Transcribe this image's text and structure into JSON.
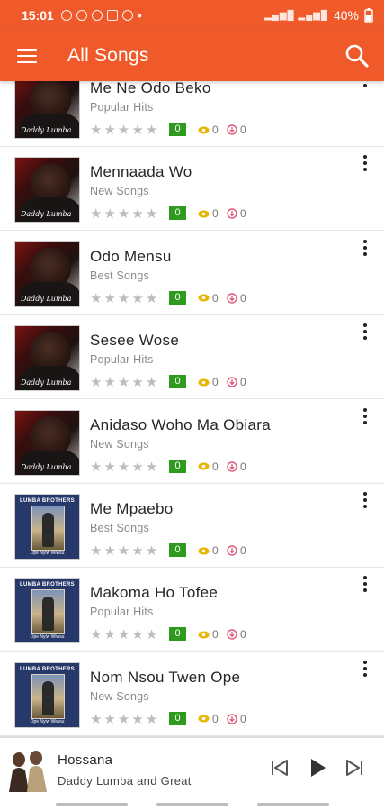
{
  "status_bar": {
    "time": "15:01",
    "battery": "40%",
    "notification_icons": [
      "whatsapp-icon",
      "whatsapp-icon",
      "whatsapp-icon",
      "gallery-icon",
      "xbox-icon",
      "dot-icon"
    ]
  },
  "app_bar": {
    "title": "All Songs",
    "menu_icon": "hamburger-menu-icon",
    "search_icon": "search-icon"
  },
  "colors": {
    "primary": "#f05a2a",
    "rating_badge": "#2e9a1e",
    "views_icon": "#e8b500",
    "downloads_icon": "#e05a7a"
  },
  "songs": [
    {
      "title": "Me Ne Odo Beko",
      "category": "Popular Hits",
      "rating": "0",
      "views": "0",
      "downloads": "0",
      "cover": "a"
    },
    {
      "title": "Mennaada Wo",
      "category": "New Songs",
      "rating": "0",
      "views": "0",
      "downloads": "0",
      "cover": "a"
    },
    {
      "title": "Odo Mensu",
      "category": "Best Songs",
      "rating": "0",
      "views": "0",
      "downloads": "0",
      "cover": "a"
    },
    {
      "title": "Sesee Wose",
      "category": "Popular Hits",
      "rating": "0",
      "views": "0",
      "downloads": "0",
      "cover": "a"
    },
    {
      "title": "Anidaso Woho Ma Obiara",
      "category": "New Songs",
      "rating": "0",
      "views": "0",
      "downloads": "0",
      "cover": "a"
    },
    {
      "title": "Me Mpaebo",
      "category": "Best Songs",
      "rating": "0",
      "views": "0",
      "downloads": "0",
      "cover": "b"
    },
    {
      "title": "Makoma Ho Tofee",
      "category": "Popular Hits",
      "rating": "0",
      "views": "0",
      "downloads": "0",
      "cover": "b"
    },
    {
      "title": "Nom Nsou Twen Ope",
      "category": "New Songs",
      "rating": "0",
      "views": "0",
      "downloads": "0",
      "cover": "b"
    }
  ],
  "now_playing": {
    "title": "Hossana",
    "artist": "Daddy Lumba and Great",
    "controls": [
      "previous-icon",
      "play-icon",
      "next-icon"
    ]
  }
}
